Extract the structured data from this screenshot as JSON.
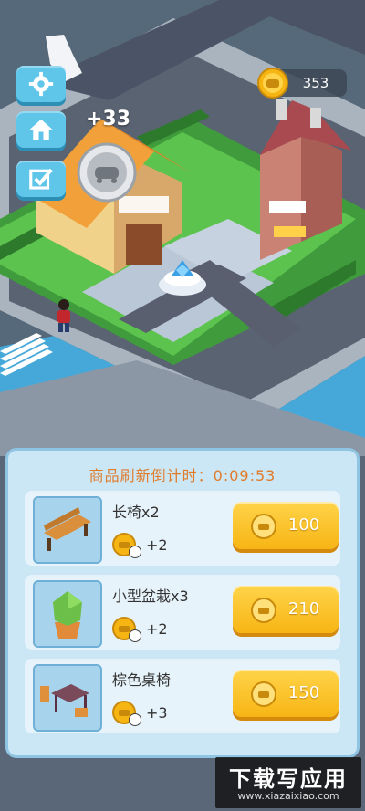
{
  "hud": {
    "coins": "353",
    "gain_text": "+33"
  },
  "side_buttons": [
    "settings",
    "home",
    "tasks"
  ],
  "shop": {
    "title": "商品刷新倒计时：0:09:53",
    "items": [
      {
        "name": "长椅x2",
        "reward": "+2",
        "price": "100",
        "icon": "bench-icon"
      },
      {
        "name": "小型盆栽x3",
        "reward": "+2",
        "price": "210",
        "icon": "potted-plant-icon"
      },
      {
        "name": "棕色桌椅",
        "reward": "+3",
        "price": "150",
        "icon": "table-chairs-icon"
      }
    ]
  },
  "watermark": {
    "main": "下载写应用",
    "sub": "www.xiazaixiao.com"
  },
  "colors": {
    "accent_orange": "#e07b2a",
    "button_gold": "#f7b514",
    "panel_blue": "#cbe6f5",
    "ui_blue": "#5fc6ea"
  }
}
